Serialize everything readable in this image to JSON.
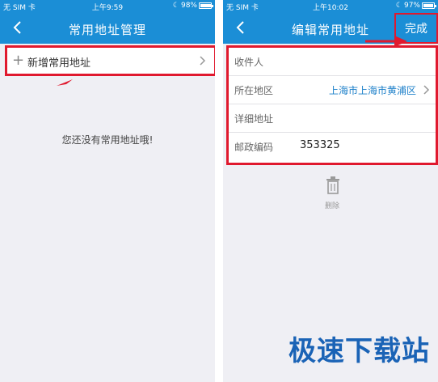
{
  "left_screen": {
    "status": {
      "carrier": "无 SIM 卡",
      "time": "上午9:59",
      "battery": "98%",
      "battery_level": 0.98
    },
    "nav": {
      "title": "常用地址管理",
      "back_icon": "chevron-left-icon"
    },
    "add_row": {
      "plus": "+",
      "label": "新增常用地址",
      "chevron_icon": "chevron-right-icon"
    },
    "empty_message": "您还没有常用地址哦!"
  },
  "right_screen": {
    "status": {
      "carrier": "无 SIM 卡",
      "time": "上午10:02",
      "battery": "97%",
      "battery_level": 0.97
    },
    "nav": {
      "title": "编辑常用地址",
      "done_label": "完成",
      "back_icon": "chevron-left-icon"
    },
    "form": {
      "recipient_label": "收件人",
      "region_label": "所在地区",
      "region_value": "上海市上海市黄浦区",
      "detail_label": "详细地址",
      "zip_label": "邮政编码",
      "zip_value": "353325"
    },
    "delete_label": "删除",
    "trash_icon": "trash-icon"
  },
  "watermark": "极速下载站",
  "colors": {
    "nav_blue": "#1b8ed6",
    "highlight_red": "#e0192e",
    "link_blue": "#1b7fc9",
    "background": "#efeff4"
  }
}
